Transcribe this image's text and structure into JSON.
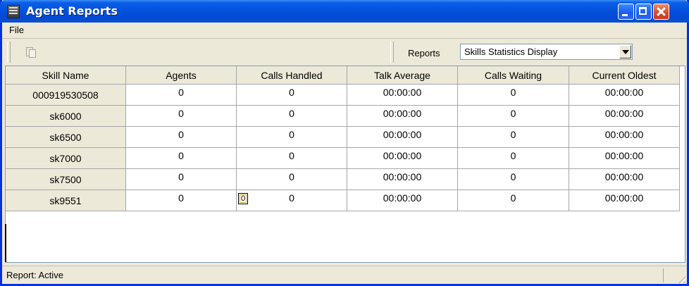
{
  "window": {
    "title": "Agent Reports",
    "menu": [
      "File"
    ]
  },
  "toolbar": {
    "reports_label": "Reports",
    "reports_selected": "Skills Statistics Display"
  },
  "table": {
    "columns": [
      "Skill Name",
      "Agents",
      "Calls Handled",
      "Talk Average",
      "Calls Waiting",
      "Current Oldest"
    ],
    "rows": [
      [
        "000919530508",
        "0",
        "0",
        "00:00:00",
        "0",
        "00:00:00"
      ],
      [
        "sk6000",
        "0",
        "0",
        "00:00:00",
        "0",
        "00:00:00"
      ],
      [
        "sk6500",
        "0",
        "0",
        "00:00:00",
        "0",
        "00:00:00"
      ],
      [
        "sk7000",
        "0",
        "0",
        "00:00:00",
        "0",
        "00:00:00"
      ],
      [
        "sk7500",
        "0",
        "0",
        "00:00:00",
        "0",
        "00:00:00"
      ],
      [
        "sk9551",
        "0",
        "0",
        "00:00:00",
        "0",
        "00:00:00"
      ]
    ],
    "focus_editor_value": "0"
  },
  "status": {
    "text": "Report: Active"
  }
}
